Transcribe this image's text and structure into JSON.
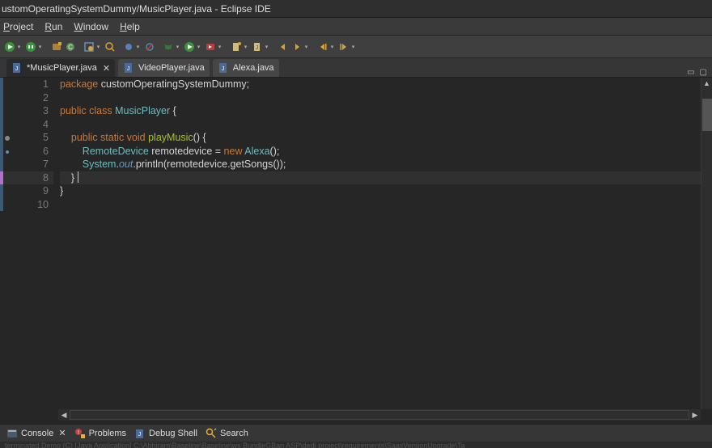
{
  "title": "ustomOperatingSystemDummy/MusicPlayer.java - Eclipse IDE",
  "menu": {
    "project": "Project",
    "run": "Run",
    "window": "Window",
    "help": "Help"
  },
  "tabs": [
    {
      "label": "*MusicPlayer.java",
      "active": true
    },
    {
      "label": "VideoPlayer.java",
      "active": false
    },
    {
      "label": "Alexa.java",
      "active": false
    }
  ],
  "code": {
    "lines": [
      {
        "n": 1,
        "parts": [
          [
            "k-pkg",
            "package "
          ],
          [
            "p",
            "customOperatingSystemDummy;"
          ]
        ]
      },
      {
        "n": 2,
        "parts": []
      },
      {
        "n": 3,
        "parts": [
          [
            "k-pkg",
            "public class "
          ],
          [
            "k-type",
            "MusicPlayer"
          ],
          [
            "p",
            " {"
          ]
        ]
      },
      {
        "n": 4,
        "parts": []
      },
      {
        "n": 5,
        "parts": [
          [
            "p",
            "    "
          ],
          [
            "k-pkg",
            "public static void "
          ],
          [
            "k-meth",
            "playMusic"
          ],
          [
            "p",
            "() {"
          ]
        ],
        "marker": "circle"
      },
      {
        "n": 6,
        "parts": [
          [
            "p",
            "        "
          ],
          [
            "k-type",
            "RemoteDevice"
          ],
          [
            "p",
            " remotedevice = "
          ],
          [
            "k-pkg",
            "new "
          ],
          [
            "k-type",
            "Alexa"
          ],
          [
            "p",
            "();"
          ]
        ],
        "marker": "dot"
      },
      {
        "n": 7,
        "parts": [
          [
            "p",
            "        "
          ],
          [
            "k-type",
            "System"
          ],
          [
            "p",
            "."
          ],
          [
            "k-out",
            "out"
          ],
          [
            "p",
            ".println(remotedevice.getSongs());"
          ]
        ]
      },
      {
        "n": 8,
        "parts": [
          [
            "p",
            "    }"
          ]
        ],
        "current": true
      },
      {
        "n": 9,
        "parts": [
          [
            "p",
            "}"
          ]
        ]
      },
      {
        "n": 10,
        "parts": []
      }
    ]
  },
  "bottom_tabs": [
    {
      "icon": "console",
      "label": "Console",
      "close": true
    },
    {
      "icon": "problems",
      "label": "Problems",
      "close": false
    },
    {
      "icon": "debug",
      "label": "Debug Shell",
      "close": false
    },
    {
      "icon": "search",
      "label": "Search",
      "close": false
    }
  ],
  "sliver": "terminated  Demo (C) [Java Application] C:\\Abhiram\\Baseline\\Baseline\\ws BundleGBan ASP\\dedi project\\requirements\\SaasVersionUpgrade\\Ta"
}
